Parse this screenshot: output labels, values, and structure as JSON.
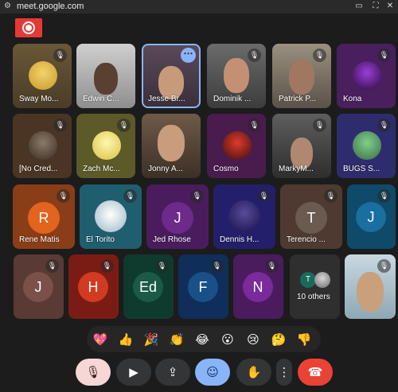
{
  "browser": {
    "url": "meet.google.com"
  },
  "colors": {
    "recording": "#e53935",
    "active_border": "#8ab4f8",
    "end_call": "#ea4335",
    "muted_control": "#f6d7d5",
    "active_control": "#8ab4f8"
  },
  "participants": {
    "sway": "Sway Mo...",
    "edwin": "Edwin C...",
    "jesse": "Jesse Br...",
    "dominik": "Dominik ...",
    "patrick": "Patrick P...",
    "kona": "Kona",
    "nocred": "[No Cred...",
    "zach": "Zach Mc...",
    "jonny": "Jonny A...",
    "cosmo": "Cosmo",
    "markym": "MarkyM...",
    "bugs": "BUGS S...",
    "rene": "Rene Matis",
    "eltorito": "El Torito",
    "jed": "Jed Rhose",
    "dennis": "Dennis H...",
    "terencio": "Terencio ..."
  },
  "initials": {
    "rene": "R",
    "terencio": "T",
    "jed": "J",
    "j_right": "J",
    "j_bottom": "J",
    "h": "H",
    "ed": "Ed",
    "f": "F",
    "n": "N",
    "others_t": "T"
  },
  "others_label": "10 others",
  "reactions": [
    "💖",
    "👍",
    "🎉",
    "👏",
    "😂",
    "😮",
    "😢",
    "🤔",
    "👎"
  ],
  "icons": {
    "mute": "mic-off-icon",
    "more": "more-options-icon",
    "camera": "camera-icon",
    "present": "present-screen-icon",
    "emoji": "emoji-icon",
    "hand": "raise-hand-icon",
    "end": "end-call-icon"
  }
}
